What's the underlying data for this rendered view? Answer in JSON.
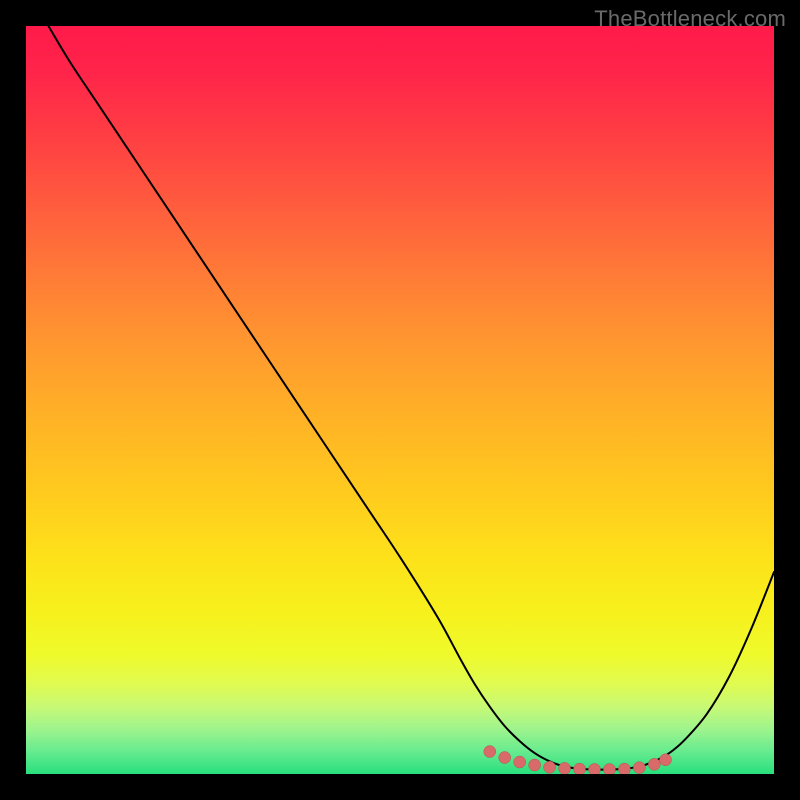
{
  "watermark": "TheBottleneck.com",
  "colors": {
    "curve": "#000000",
    "marker": "#d96a6a",
    "marker_stroke": "#b84f4f"
  },
  "chart_data": {
    "type": "line",
    "title": "",
    "xlabel": "",
    "ylabel": "",
    "xlim": [
      0,
      100
    ],
    "ylim": [
      0,
      100
    ],
    "x": [
      3,
      6,
      10,
      15,
      20,
      25,
      30,
      35,
      40,
      45,
      50,
      55,
      58,
      60,
      62,
      64,
      66,
      68,
      70,
      72,
      74,
      76,
      78,
      80,
      82,
      84,
      86,
      88,
      91,
      94,
      97,
      100
    ],
    "y": [
      100,
      95,
      89,
      81.5,
      74,
      66.5,
      59,
      51.5,
      44,
      36.5,
      29,
      21,
      15.5,
      12,
      9,
      6.4,
      4.4,
      2.8,
      1.7,
      1.0,
      0.7,
      0.6,
      0.6,
      0.7,
      1.0,
      1.7,
      2.8,
      4.5,
      8.0,
      13,
      19.5,
      27
    ],
    "markers": {
      "x": [
        62,
        64,
        66,
        68,
        70,
        72,
        74,
        76,
        78,
        80,
        82,
        84,
        85.5
      ],
      "y": [
        3.0,
        2.2,
        1.6,
        1.2,
        0.9,
        0.75,
        0.65,
        0.6,
        0.6,
        0.65,
        0.85,
        1.3,
        1.9
      ]
    },
    "description": "Bottleneck curve with gradient background from red (high bottleneck) at top to green (optimal) at bottom. Curve descends steeply from upper-left, reaches a flat minimum around x≈70–82, then rises toward the right. Salmon markers highlight the flat optimal region near the bottom."
  }
}
